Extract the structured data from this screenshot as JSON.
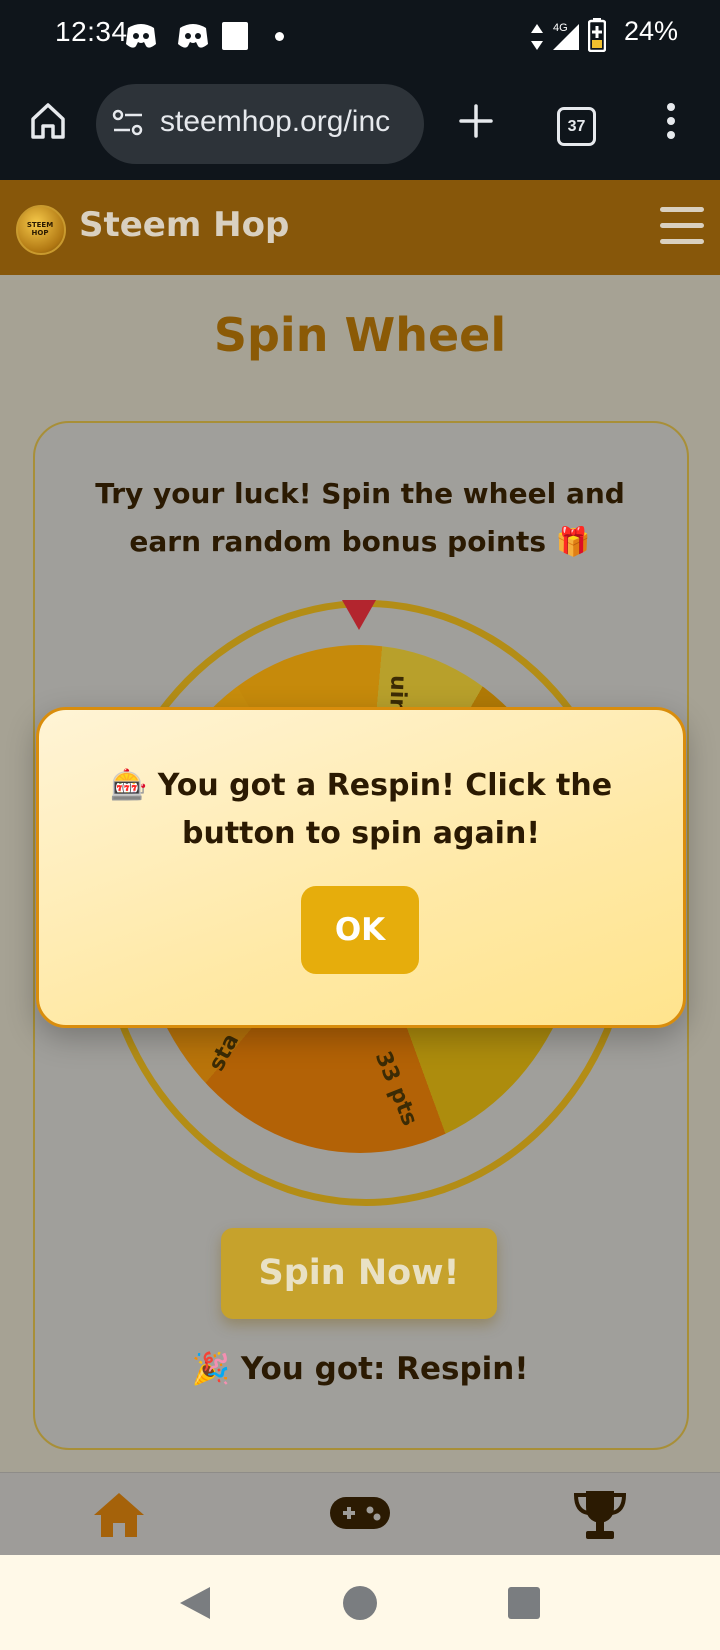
{
  "status_bar": {
    "time": "12:34",
    "network": "4G",
    "battery": "24%"
  },
  "browser": {
    "url": "steemhop.org/inc",
    "tab_count": "37"
  },
  "site": {
    "brand": "Steem Hop",
    "logo_text": "STEEM HOP"
  },
  "page": {
    "title": "Spin Wheel",
    "intro": "Try your luck! Spin the wheel and earn random bonus points 🎁",
    "spin_button": "Spin Now!",
    "result": "🎉 You got: Respin!"
  },
  "wheel": {
    "labels": [
      "uin",
      "33 pts",
      "sta"
    ]
  },
  "modal": {
    "message": "🎰 You got a Respin! Click the button to spin again!",
    "ok_button": "OK"
  },
  "colors": {
    "header": "#87570a",
    "accent": "#e6ad0c",
    "title": "#8b5a06",
    "pointer": "#b3252e"
  },
  "icons": {
    "bottom_nav": [
      "home-icon",
      "gamepad-icon",
      "trophy-icon"
    ]
  }
}
